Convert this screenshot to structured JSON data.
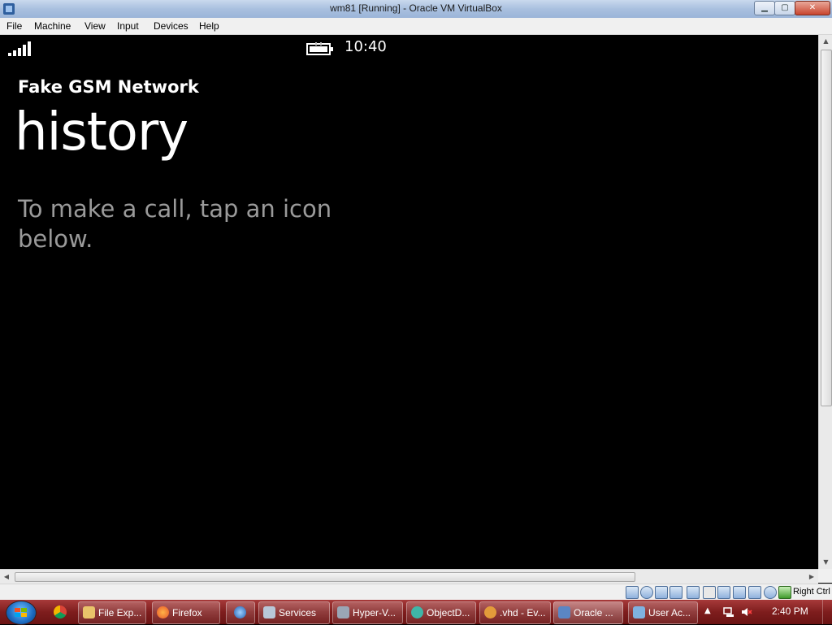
{
  "window": {
    "title": "wm81 [Running] - Oracle VM VirtualBox",
    "min_symbol": "▁",
    "max_symbol": "▢",
    "close_symbol": "✕"
  },
  "menu": [
    "File",
    "Machine",
    "View",
    "Input",
    "Devices",
    "Help"
  ],
  "phone": {
    "clock": "10:40",
    "network": "Fake GSM Network",
    "page_title": "history",
    "instruction": "To make a call, tap an icon below.",
    "text_color": "#ffffff",
    "muted_color": "#9a9a9a"
  },
  "scrollbars": {
    "up": "▲",
    "down": "▼",
    "left": "◀",
    "right": "▶"
  },
  "statusbar": {
    "host_key": "Right Ctrl"
  },
  "taskbar": {
    "items": [
      {
        "label": "File Exp..."
      },
      {
        "label": "Firefox"
      },
      {
        "label": "Services"
      },
      {
        "label": "Hyper-V..."
      },
      {
        "label": "ObjectD..."
      },
      {
        "label": ".vhd - Ev..."
      },
      {
        "label": "Oracle ..."
      },
      {
        "label": "User Ac..."
      }
    ],
    "tray_arrow": "▲",
    "time": "2:40 PM"
  }
}
